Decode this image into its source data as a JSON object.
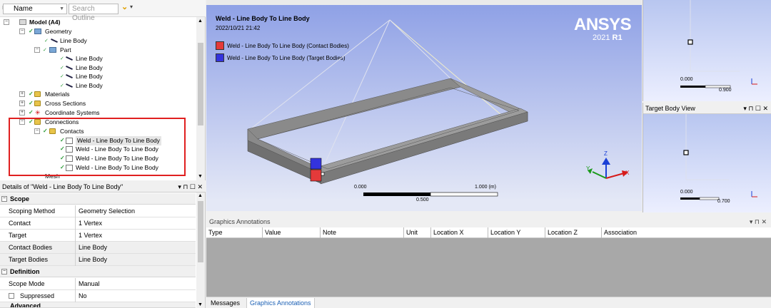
{
  "tree": {
    "name_selector": "Name",
    "search_placeholder": "Search Outline",
    "model": "Model (A4)",
    "geometry": "Geometry",
    "line_body_1": "Line Body",
    "part": "Part",
    "part_items": [
      "Line Body",
      "Line Body",
      "Line Body",
      "Line Body"
    ],
    "materials": "Materials",
    "cross_sections": "Cross Sections",
    "coordinate_systems": "Coordinate Systems",
    "connections": "Connections",
    "contacts": "Contacts",
    "welds": [
      "Weld - Line Body To Line Body",
      "Weld - Line Body To Line Body",
      "Weld - Line Body To Line Body",
      "Weld - Line Body To Line Body"
    ],
    "mesh": "Mesh"
  },
  "details": {
    "title": "Details of \"Weld - Line Body To Line Body\"",
    "controls": "▾ ⊓ ☐ ✕",
    "scope_group": "Scope",
    "definition_group": "Definition",
    "advanced_group": "Advanced",
    "rows": [
      {
        "k": "Scoping Method",
        "v": "Geometry Selection"
      },
      {
        "k": "Contact",
        "v": "1 Vertex"
      },
      {
        "k": "Target",
        "v": "1 Vertex"
      },
      {
        "k": "Contact Bodies",
        "v": "Line Body"
      },
      {
        "k": "Target Bodies",
        "v": "Line Body"
      }
    ],
    "scope_mode": {
      "k": "Scope Mode",
      "v": "Manual"
    },
    "suppressed": {
      "k": "Suppressed",
      "v": "No"
    }
  },
  "viewport": {
    "title": "Weld - Line Body To Line Body",
    "date": "2022/10/21 21:42",
    "legend_contact": "Weld - Line Body To Line Body (Contact Bodies)",
    "legend_target": "Weld - Line Body To Line Body (Target Bodies)",
    "brand": "ANSYS",
    "version_num": "2021",
    "version_r": "R1",
    "scale_start": "0.000",
    "scale_mid": "0.500",
    "scale_end": "1.000 (m)",
    "axis_x": "X",
    "axis_y": "Y",
    "axis_z": "Z",
    "colors": {
      "contact": "#e43a3a",
      "target": "#3333dd"
    }
  },
  "right_view1": {
    "scale_start": "0.000",
    "scale_end": "0.900"
  },
  "right_view2": {
    "title": "Target Body View",
    "controls": "▾ ⊓ ☐ ✕",
    "scale_start": "0.000",
    "scale_end": "0.700"
  },
  "annotations": {
    "title": "Graphics Annotations",
    "controls": "▾ ⊓ ✕",
    "columns": [
      "Type",
      "Value",
      "Note",
      "Unit",
      "Location X",
      "Location Y",
      "Location Z",
      "Association"
    ]
  },
  "tabs": [
    "Messages",
    "Graphics Annotations"
  ]
}
